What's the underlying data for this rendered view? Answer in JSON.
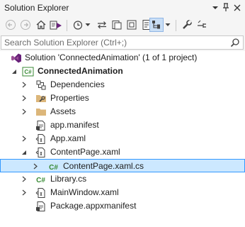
{
  "window": {
    "title": "Solution Explorer",
    "controls": [
      "dropdown-arrow",
      "pin",
      "close"
    ]
  },
  "search": {
    "placeholder": "Search Solution Explorer (Ctrl+;)",
    "value": ""
  },
  "tree": {
    "solution_label": "Solution 'ConnectedAnimation' (1 of 1 project)",
    "project_label": "ConnectedAnimation",
    "items": [
      {
        "label": "Dependencies",
        "icon": "dependencies-icon",
        "expander": "collapsed"
      },
      {
        "label": "Properties",
        "icon": "wrench-folder-icon",
        "expander": "collapsed"
      },
      {
        "label": "Assets",
        "icon": "folder-icon",
        "expander": "collapsed"
      },
      {
        "label": "app.manifest",
        "icon": "manifest-file-icon",
        "expander": "none"
      },
      {
        "label": "App.xaml",
        "icon": "xaml-file-icon",
        "expander": "collapsed"
      },
      {
        "label": "ContentPage.xaml",
        "icon": "xaml-file-icon",
        "expander": "expanded"
      },
      {
        "label": "ContentPage.xaml.cs",
        "icon": "csharp-file-icon",
        "expander": "collapsed",
        "selected": true
      },
      {
        "label": "Library.cs",
        "icon": "csharp-file-icon",
        "expander": "collapsed"
      },
      {
        "label": "MainWindow.xaml",
        "icon": "xaml-file-icon",
        "expander": "collapsed"
      },
      {
        "label": "Package.appxmanifest",
        "icon": "manifest-file-icon",
        "expander": "none"
      }
    ]
  },
  "colors": {
    "accent": "#3399ff",
    "selection": "#cce8ff",
    "csharp_green": "#388a34",
    "folder": "#dcb67a",
    "vs_purple": "#68217a"
  }
}
